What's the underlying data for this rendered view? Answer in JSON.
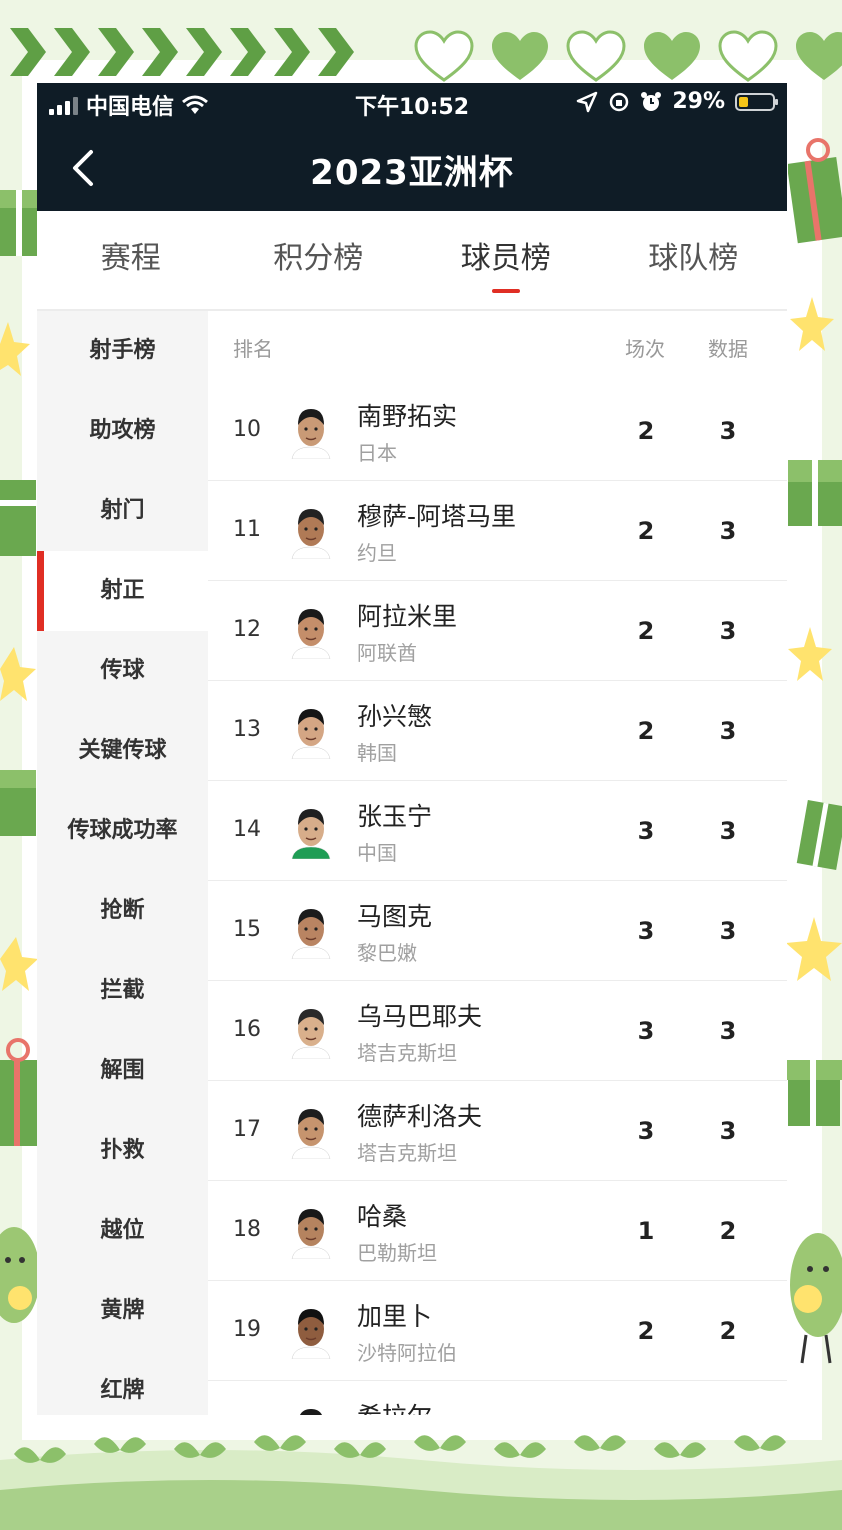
{
  "status_bar": {
    "carrier": "中国电信",
    "time": "下午10:52",
    "battery_percent": "29%",
    "battery_level": 0.29
  },
  "nav": {
    "title": "2023亚洲杯",
    "back_icon": "chevron-left-icon"
  },
  "tabs": [
    {
      "label": "赛程",
      "active": false
    },
    {
      "label": "积分榜",
      "active": false
    },
    {
      "label": "球员榜",
      "active": true
    },
    {
      "label": "球队榜",
      "active": false
    }
  ],
  "sidebar": {
    "items": [
      {
        "label": "射手榜",
        "active": false
      },
      {
        "label": "助攻榜",
        "active": false
      },
      {
        "label": "射门",
        "active": false
      },
      {
        "label": "射正",
        "active": true
      },
      {
        "label": "传球",
        "active": false
      },
      {
        "label": "关键传球",
        "active": false
      },
      {
        "label": "传球成功率",
        "active": false
      },
      {
        "label": "抢断",
        "active": false
      },
      {
        "label": "拦截",
        "active": false
      },
      {
        "label": "解围",
        "active": false
      },
      {
        "label": "扑救",
        "active": false
      },
      {
        "label": "越位",
        "active": false
      },
      {
        "label": "黄牌",
        "active": false
      },
      {
        "label": "红牌",
        "active": false
      }
    ]
  },
  "table": {
    "headers": {
      "rank": "排名",
      "games": "场次",
      "data": "数据"
    },
    "rows": [
      {
        "rank": "10",
        "name": "南野拓实",
        "country": "日本",
        "games": "2",
        "value": "3"
      },
      {
        "rank": "11",
        "name": "穆萨-阿塔马里",
        "country": "约旦",
        "games": "2",
        "value": "3"
      },
      {
        "rank": "12",
        "name": "阿拉米里",
        "country": "阿联酋",
        "games": "2",
        "value": "3"
      },
      {
        "rank": "13",
        "name": "孙兴慜",
        "country": "韩国",
        "games": "2",
        "value": "3"
      },
      {
        "rank": "14",
        "name": "张玉宁",
        "country": "中国",
        "games": "3",
        "value": "3"
      },
      {
        "rank": "15",
        "name": "马图克",
        "country": "黎巴嫩",
        "games": "3",
        "value": "3"
      },
      {
        "rank": "16",
        "name": "乌马巴耶夫",
        "country": "塔吉克斯坦",
        "games": "3",
        "value": "3"
      },
      {
        "rank": "17",
        "name": "德萨利洛夫",
        "country": "塔吉克斯坦",
        "games": "3",
        "value": "3"
      },
      {
        "rank": "18",
        "name": "哈桑",
        "country": "巴勒斯坦",
        "games": "1",
        "value": "2"
      },
      {
        "rank": "19",
        "name": "加里卜",
        "country": "沙特阿拉伯",
        "games": "2",
        "value": "2"
      },
      {
        "rank": "",
        "name": "希拉尔",
        "country": "",
        "games": "",
        "value": ""
      }
    ]
  },
  "colors": {
    "header_bg": "#0f1c26",
    "accent": "#e02e24",
    "sidebar_bg": "#f5f5f5",
    "frame_green": "#6aa84f"
  }
}
